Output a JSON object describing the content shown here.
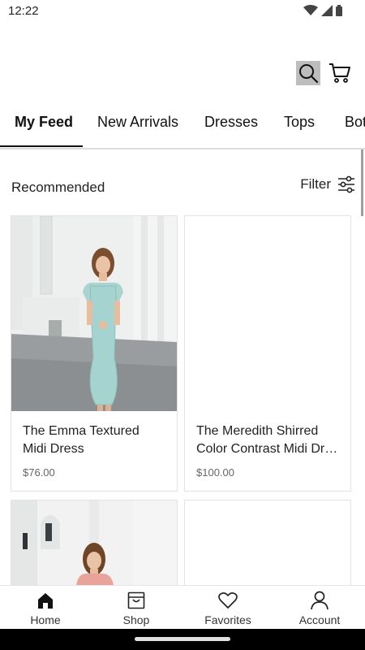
{
  "status_bar": {
    "time": "12:22",
    "icons": [
      "wifi-icon",
      "signal-icon",
      "battery-icon"
    ]
  },
  "header": {
    "search_icon": "search-icon",
    "cart_icon": "cart-icon"
  },
  "tabs": [
    {
      "label": "My Feed",
      "active": true
    },
    {
      "label": "New Arrivals",
      "active": false
    },
    {
      "label": "Dresses",
      "active": false
    },
    {
      "label": "Tops",
      "active": false
    },
    {
      "label": "Bot",
      "active": false
    }
  ],
  "section": {
    "title": "Recommended",
    "filter_label": "Filter",
    "filter_icon": "sliders-icon"
  },
  "products": [
    {
      "name_line1": "The Emma Textured",
      "name_line2": "Midi Dress",
      "price": "$76.00",
      "image": "woman-in-mint-midi-dress"
    },
    {
      "name_line1": "The Meredith Shirred",
      "name_line2": "Color Contrast Midi Dr…",
      "price": "$100.00",
      "image": "blank"
    },
    {
      "image": "woman-in-pink-top"
    },
    {
      "image": "blank"
    }
  ],
  "bottom_nav": [
    {
      "label": "Home",
      "icon": "home-icon",
      "active": true
    },
    {
      "label": "Shop",
      "icon": "shopping-bag-icon",
      "active": false
    },
    {
      "label": "Favorites",
      "icon": "heart-icon",
      "active": false
    },
    {
      "label": "Account",
      "icon": "person-icon",
      "active": false
    }
  ],
  "colors": {
    "accent": "#111111",
    "search_highlight": "#bdbdbd",
    "divider": "#dcdcdc"
  }
}
